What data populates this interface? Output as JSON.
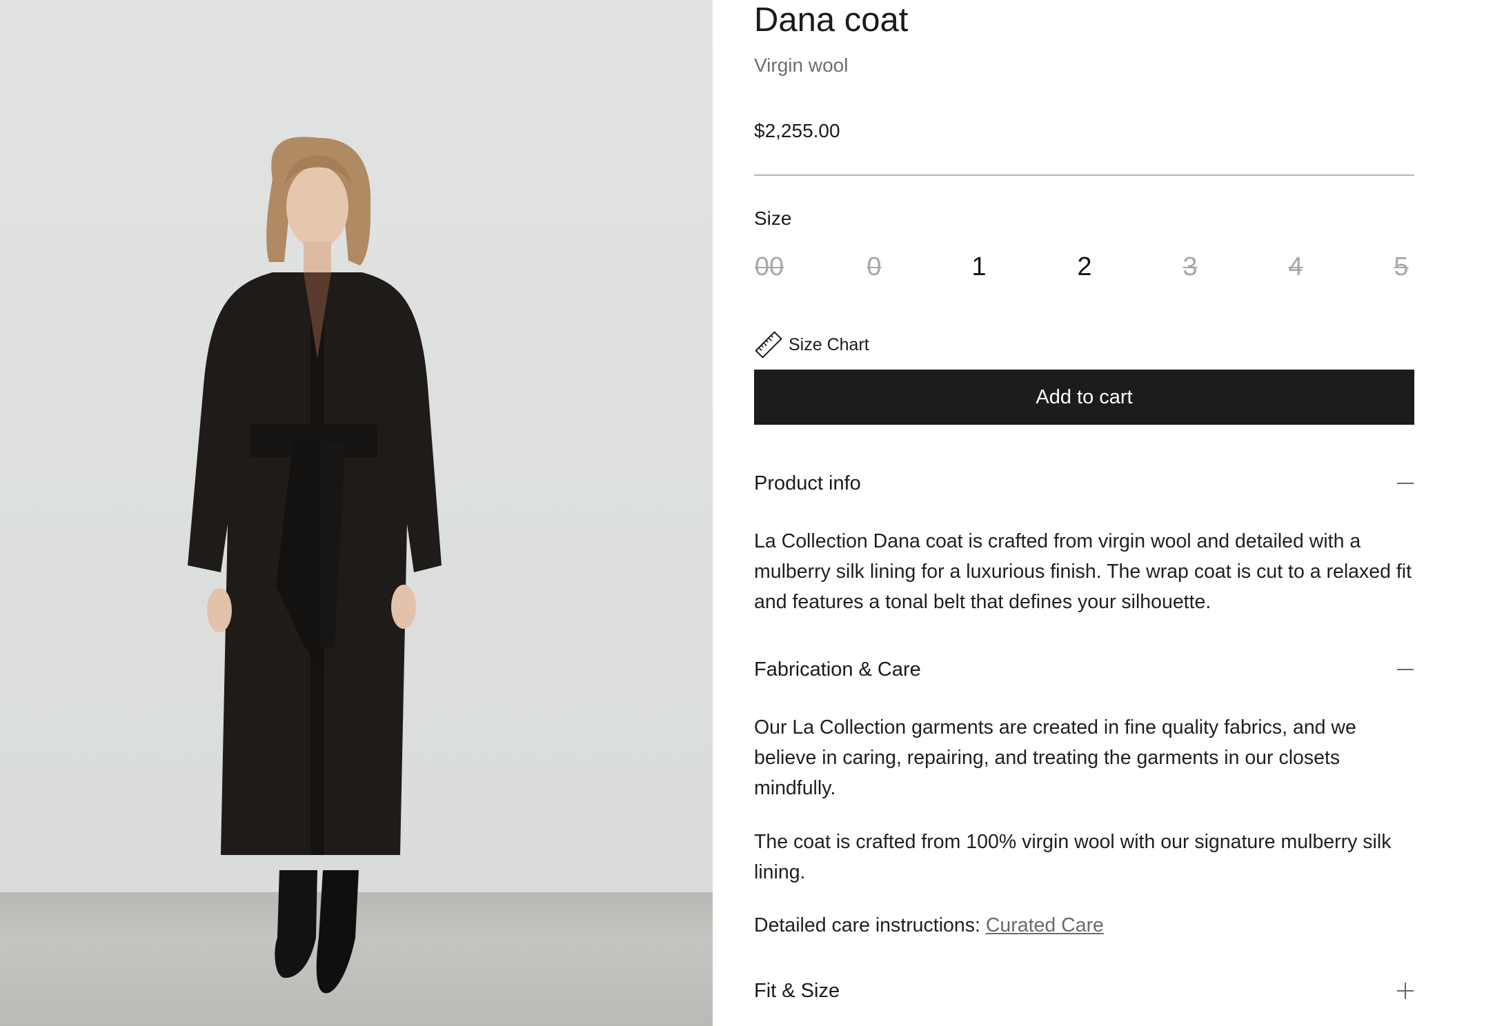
{
  "product": {
    "name": "Dana coat",
    "material": "Virgin wool",
    "price": "$2,255.00",
    "photo_icon": "product-photo"
  },
  "size_selector": {
    "label": "Size",
    "options": [
      {
        "label": "00",
        "available": false
      },
      {
        "label": "0",
        "available": false
      },
      {
        "label": "1",
        "available": true
      },
      {
        "label": "2",
        "available": true
      },
      {
        "label": "3",
        "available": false
      },
      {
        "label": "4",
        "available": false
      },
      {
        "label": "5",
        "available": false
      }
    ]
  },
  "size_chart": {
    "label": "Size Chart",
    "icon": "ruler-icon"
  },
  "cart": {
    "add_label": "Add to cart"
  },
  "accordion": {
    "product_info": {
      "title": "Product info",
      "state": "expanded",
      "icon": "minus-icon",
      "body": "La Collection Dana coat is crafted from virgin wool and detailed with a mulberry silk lining for a luxurious finish. The wrap coat is cut to a relaxed fit and features a tonal belt that defines your silhouette."
    },
    "fabrication_care": {
      "title": "Fabrication & Care",
      "state": "expanded",
      "icon": "minus-icon",
      "body_1": "Our La Collection garments are created in fine quality fabrics, and we believe in caring, repairing, and treating the garments in our closets mindfully.",
      "body_2": "The coat is crafted from 100% virgin wool with our signature mulberry silk lining.",
      "care_prefix": "Detailed care instructions: ",
      "care_link": "Curated Care"
    },
    "fit_size": {
      "title": "Fit & Size",
      "state": "collapsed",
      "icon": "plus-icon"
    }
  },
  "colors": {
    "button_bg": "#1c1c1c",
    "button_text": "#ffffff",
    "muted_text": "#6e6e6e",
    "unavailable_size": "#a7a7a7"
  }
}
